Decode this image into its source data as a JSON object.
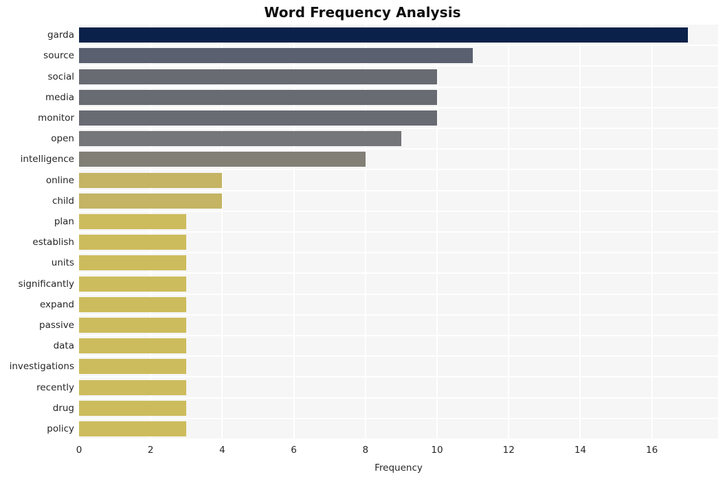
{
  "chart_data": {
    "type": "bar",
    "orientation": "horizontal",
    "title": "Word Frequency Analysis",
    "xlabel": "Frequency",
    "ylabel": "",
    "xlim": [
      0,
      17.85
    ],
    "xticks": [
      0,
      2,
      4,
      6,
      8,
      10,
      12,
      14,
      16
    ],
    "xticklabels": [
      "0",
      "2",
      "4",
      "6",
      "8",
      "10",
      "12",
      "14",
      "16"
    ],
    "grid": true,
    "legend": null,
    "categories": [
      "garda",
      "source",
      "social",
      "media",
      "monitor",
      "open",
      "intelligence",
      "online",
      "child",
      "plan",
      "establish",
      "units",
      "significantly",
      "expand",
      "passive",
      "data",
      "investigations",
      "recently",
      "drug",
      "policy"
    ],
    "values": [
      17,
      11,
      10,
      10,
      10,
      9,
      8,
      4,
      4,
      3,
      3,
      3,
      3,
      3,
      3,
      3,
      3,
      3,
      3,
      3
    ],
    "bar_colors": [
      "#0a2149",
      "#5b6070",
      "#696b73",
      "#696b73",
      "#696b73",
      "#757679",
      "#827f77",
      "#c4b464",
      "#c4b464",
      "#cdbc5d",
      "#cdbc5d",
      "#cdbc5d",
      "#cdbc5d",
      "#cdbc5d",
      "#cdbc5d",
      "#cdbc5d",
      "#cdbc5d",
      "#cdbc5d",
      "#cdbc5d",
      "#cdbc5d"
    ],
    "plot_background": "#f6f6f7",
    "gridline_color": "#ffffff",
    "title_color": "#0d0d0d",
    "tick_label_color": "#262626"
  }
}
